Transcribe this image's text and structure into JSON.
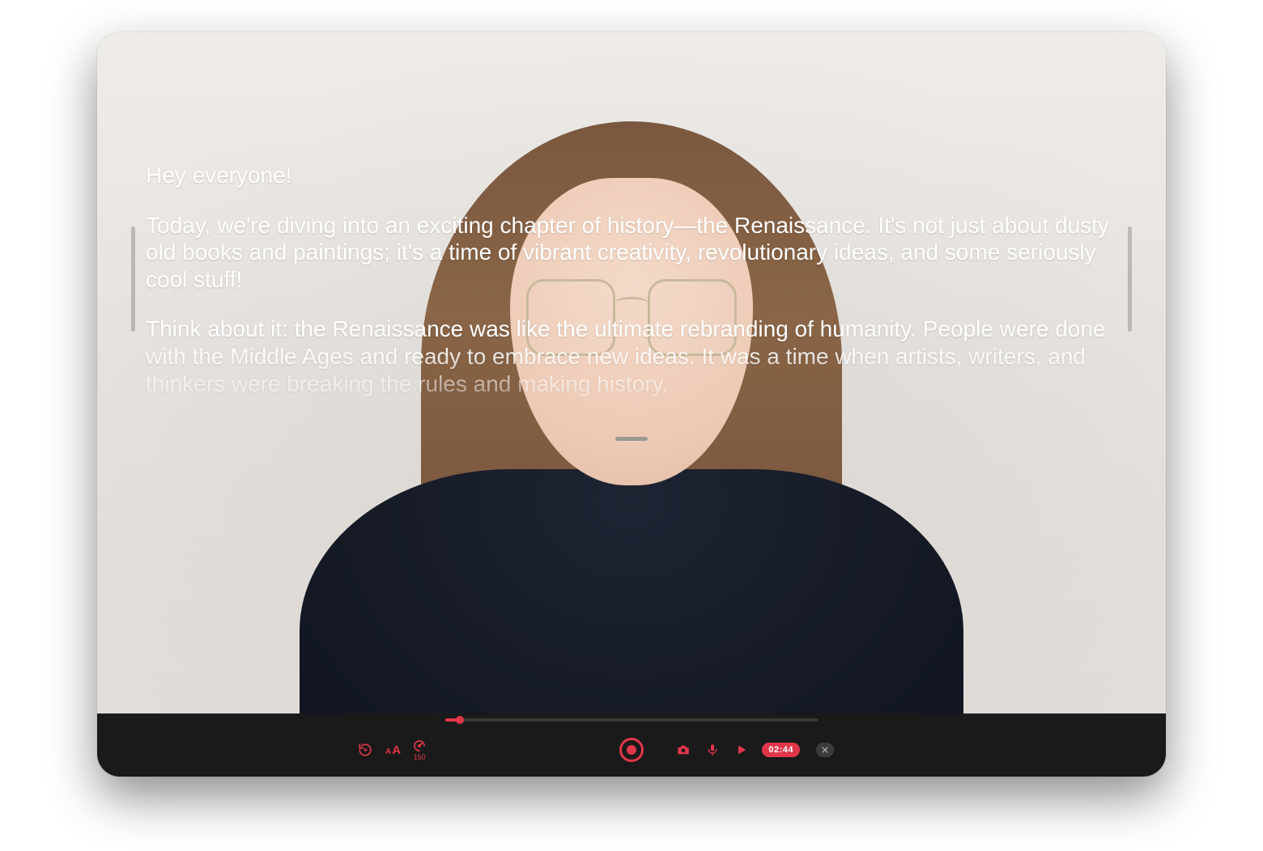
{
  "teleprompter": {
    "paragraphs": [
      "Hey everyone!",
      "Today, we're diving into an exciting chapter of history—the Renaissance. It's not just about dusty old books and paintings; it's a time of vibrant creativity, revolutionary ideas, and some seriously cool stuff!",
      "Think about it: the Renaissance was like the ultimate rebranding of humanity. People were done with the Middle Ages and ready to embrace new ideas. It was a time when artists, writers, and thinkers were breaking the rules and making history."
    ]
  },
  "controls": {
    "speed_value": "150",
    "timer": "02:44",
    "progress_percent": 4
  },
  "colors": {
    "accent": "#e1364a",
    "bar_bg": "#1a1a1a"
  }
}
